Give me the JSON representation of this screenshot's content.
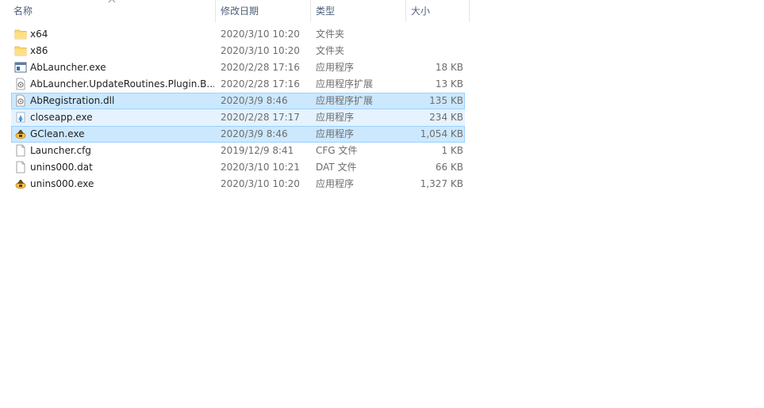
{
  "columns": {
    "name": "名称",
    "date": "修改日期",
    "type": "类型",
    "size": "大小"
  },
  "files": [
    {
      "name": "x64",
      "date": "2020/3/10 10:20",
      "type": "文件夹",
      "size": "",
      "icon": "folder-icon",
      "state": "normal"
    },
    {
      "name": "x86",
      "date": "2020/3/10 10:20",
      "type": "文件夹",
      "size": "",
      "icon": "folder-icon",
      "state": "normal"
    },
    {
      "name": "AbLauncher.exe",
      "date": "2020/2/28 17:16",
      "type": "应用程序",
      "size": "18 KB",
      "icon": "application-window-icon",
      "state": "normal"
    },
    {
      "name": "AbLauncher.UpdateRoutines.Plugin.B...",
      "date": "2020/2/28 17:16",
      "type": "应用程序扩展",
      "size": "13 KB",
      "icon": "dll-gear-icon",
      "state": "normal"
    },
    {
      "name": "AbRegistration.dll",
      "date": "2020/3/9 8:46",
      "type": "应用程序扩展",
      "size": "135 KB",
      "icon": "dll-gear-icon",
      "state": "selected"
    },
    {
      "name": "closeapp.exe",
      "date": "2020/2/28 17:17",
      "type": "应用程序",
      "size": "234 KB",
      "icon": "closeapp-icon",
      "state": "hover"
    },
    {
      "name": "GClean.exe",
      "date": "2020/3/9 8:46",
      "type": "应用程序",
      "size": "1,054 KB",
      "icon": "installer-icon",
      "state": "selected"
    },
    {
      "name": "Launcher.cfg",
      "date": "2019/12/9 8:41",
      "type": "CFG 文件",
      "size": "1 KB",
      "icon": "blank-file-icon",
      "state": "normal"
    },
    {
      "name": "unins000.dat",
      "date": "2020/3/10 10:21",
      "type": "DAT 文件",
      "size": "66 KB",
      "icon": "blank-file-icon",
      "state": "normal"
    },
    {
      "name": "unins000.exe",
      "date": "2020/3/10 10:20",
      "type": "应用程序",
      "size": "1,327 KB",
      "icon": "installer-icon",
      "state": "normal"
    }
  ],
  "colors": {
    "selected_bg": "#cce8ff",
    "selected_border": "#99d1ff",
    "hover_bg": "#e5f3ff",
    "header_text": "#4c607a",
    "folder": "#ffd766"
  }
}
